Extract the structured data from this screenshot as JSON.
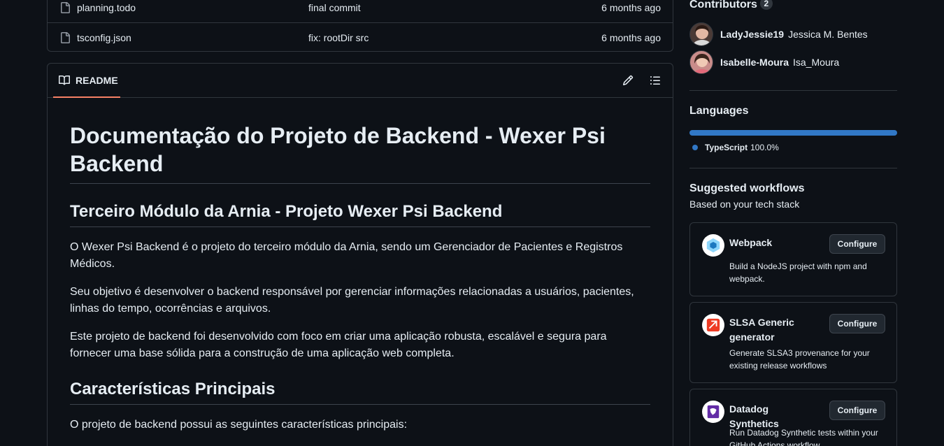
{
  "files": [
    {
      "name": "planning.todo",
      "message": "final commit",
      "age": "6 months ago"
    },
    {
      "name": "tsconfig.json",
      "message": "fix: rootDir src",
      "age": "6 months ago"
    }
  ],
  "readme": {
    "tab_label": "README",
    "h1": "Documentação do Projeto de Backend - Wexer Psi Backend",
    "h2_module": "Terceiro Módulo da Arnia - Projeto Wexer Psi Backend",
    "p1": "O Wexer Psi Backend é o projeto do terceiro módulo da Arnia, sendo um Gerenciador de Pacientes e Registros Médicos.",
    "p2": "Seu objetivo é desenvolver o backend responsável por gerenciar informações relacionadas a usuários, pacientes, linhas do tempo, ocorrências e arquivos.",
    "p3": "Este projeto de backend foi desenvolvido com foco em criar uma aplicação robusta, escalável e segura para fornecer uma base sólida para a construção de uma aplicação web completa.",
    "h2_features": "Características Principais",
    "p4": "O projeto de backend possui as seguintes características principais:"
  },
  "sidebar": {
    "contributors": {
      "title": "Contributors",
      "count": "2",
      "people": [
        {
          "login": "LadyJessie19",
          "name": "Jessica M. Bentes"
        },
        {
          "login": "Isabelle-Moura",
          "name": "Isa_Moura"
        }
      ]
    },
    "languages": {
      "title": "Languages",
      "items": [
        {
          "name": "TypeScript",
          "percent": "100.0%",
          "share": 1.0,
          "color": "#3178c6"
        }
      ]
    },
    "workflows": {
      "title": "Suggested workflows",
      "subtitle": "Based on your tech stack",
      "items": [
        {
          "title": "Webpack",
          "description": "Build a NodeJS project with npm and webpack.",
          "button": "Configure",
          "icon": "webpack-icon"
        },
        {
          "title": "SLSA Generic generator",
          "description": "Generate SLSA3 provenance for your existing release workflows",
          "button": "Configure",
          "icon": "slsa-icon"
        },
        {
          "title": "Datadog Synthetics",
          "description": "Run Datadog Synthetic tests within your GitHub Actions workflow",
          "button": "Configure",
          "icon": "datadog-icon"
        }
      ]
    }
  }
}
